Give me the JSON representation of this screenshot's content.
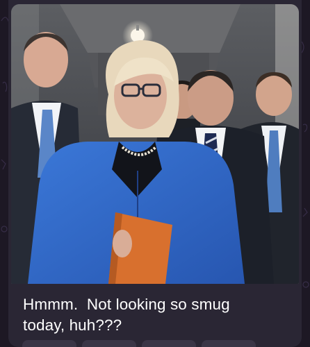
{
  "message": {
    "caption": "Hmmm.  Not looking so smug\ntoday, huh???",
    "photo_subject": "group-photo"
  },
  "colors": {
    "bubble_bg": "#2a2634",
    "screen_bg": "#1d1824",
    "caption_text": "#ffffff",
    "blue_jacket": "#2f67c8",
    "folder": "#d86a2a"
  },
  "icons": {
    "reaction_chip": "reaction-chip-icon"
  }
}
